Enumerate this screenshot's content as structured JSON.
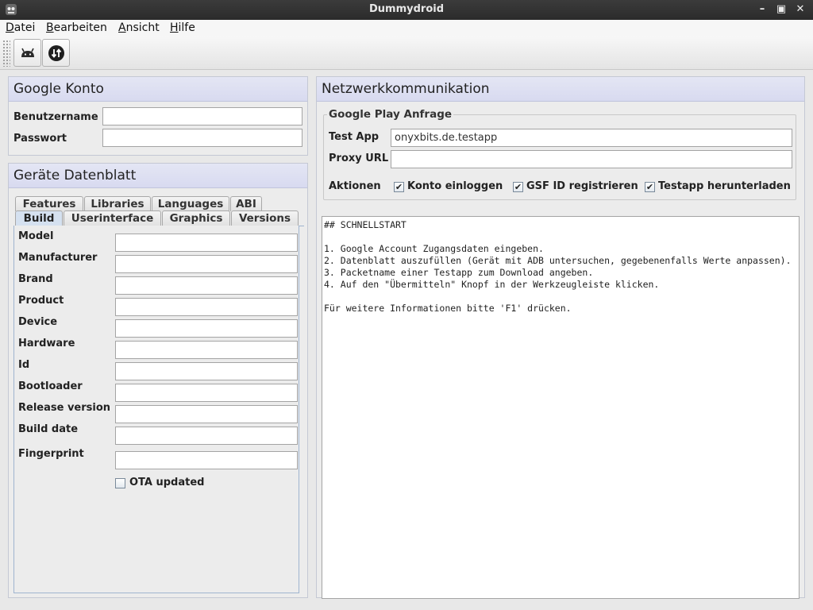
{
  "window": {
    "title": "Dummydroid"
  },
  "menu": [
    "Datei",
    "Bearbeiten",
    "Ansicht",
    "Hilfe"
  ],
  "toolbar": {
    "icons": [
      "android-icon",
      "sync-icon"
    ]
  },
  "konto": {
    "title": "Google Konto",
    "username_label": "Benutzername",
    "username_value": "",
    "password_label": "Passwort",
    "password_value": ""
  },
  "datenblatt": {
    "title": "Geräte Datenblatt",
    "tabs_row1": [
      "Features",
      "Libraries",
      "Languages",
      "ABI"
    ],
    "tabs_row2": [
      "Build",
      "Userinterface",
      "Graphics",
      "Versions"
    ],
    "active_tab": "Build",
    "fields": [
      {
        "label": "Model",
        "value": ""
      },
      {
        "label": "Manufacturer",
        "value": ""
      },
      {
        "label": "Brand",
        "value": ""
      },
      {
        "label": "Product",
        "value": ""
      },
      {
        "label": "Device",
        "value": ""
      },
      {
        "label": "Hardware",
        "value": ""
      },
      {
        "label": "Id",
        "value": ""
      },
      {
        "label": "Bootloader",
        "value": ""
      },
      {
        "label": "Release version",
        "value": ""
      },
      {
        "label": "Build date",
        "value": ""
      },
      {
        "label": "Fingerprint",
        "value": ""
      }
    ],
    "ota_label": "OTA updated",
    "ota_checked": false
  },
  "netzwerk": {
    "title": "Netzwerkkommunikation",
    "group_title": "Google Play Anfrage",
    "testapp_label": "Test App",
    "testapp_value": "onyxbits.de.testapp",
    "proxy_label": "Proxy URL",
    "proxy_value": "",
    "aktionen_label": "Aktionen",
    "actions": [
      {
        "label": "Konto einloggen",
        "checked": true
      },
      {
        "label": "GSF ID registrieren",
        "checked": true
      },
      {
        "label": "Testapp herunterladen",
        "checked": true
      }
    ],
    "log_lines": [
      "## SCHNELLSTART",
      "",
      "1. Google Account Zugangsdaten eingeben.",
      "2. Datenblatt auszufüllen (Gerät mit ADB untersuchen, gegebenenfalls Werte anpassen).",
      "3. Packetname einer Testapp zum Download angeben.",
      "4. Auf den \"Übermitteln\" Knopf in der Werkzeugleiste klicken.",
      "",
      "Für weitere Informationen bitte 'F1' drücken."
    ]
  },
  "colors": {
    "titlebar": "#2b2b2b",
    "panel_header": "#d8daf0",
    "active_tab": "#d5e1f0"
  }
}
